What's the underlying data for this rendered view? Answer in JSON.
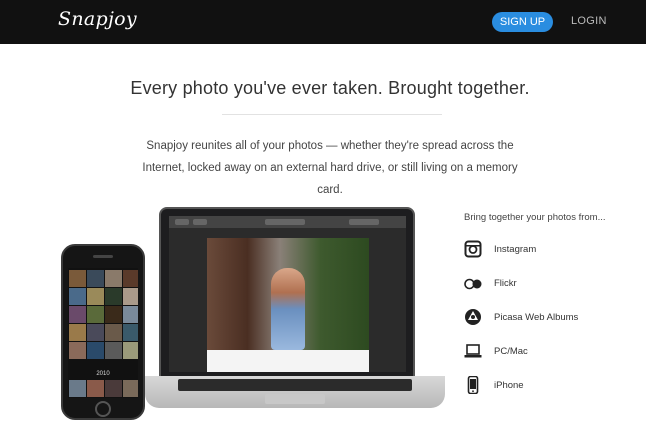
{
  "header": {
    "logo": "Snapjoy",
    "signup_label": "SIGN UP",
    "login_label": "LOGIN"
  },
  "hero": {
    "headline": "Every photo you've ever taken. Brought together.",
    "tagline": "Snapjoy reunites all of your photos — whether they're spread across the Internet, locked away on an external hard drive, or still living on a memory card."
  },
  "phone": {
    "year_label": "2010"
  },
  "sources": {
    "title": "Bring together your photos from...",
    "items": [
      {
        "label": "Instagram",
        "icon": "instagram-icon"
      },
      {
        "label": "Flickr",
        "icon": "flickr-icon"
      },
      {
        "label": "Picasa Web Albums",
        "icon": "picasa-icon"
      },
      {
        "label": "PC/Mac",
        "icon": "laptop-icon"
      },
      {
        "label": "iPhone",
        "icon": "iphone-icon"
      }
    ]
  },
  "colors": {
    "topbar": "#111111",
    "accent": "#2a8de0"
  }
}
